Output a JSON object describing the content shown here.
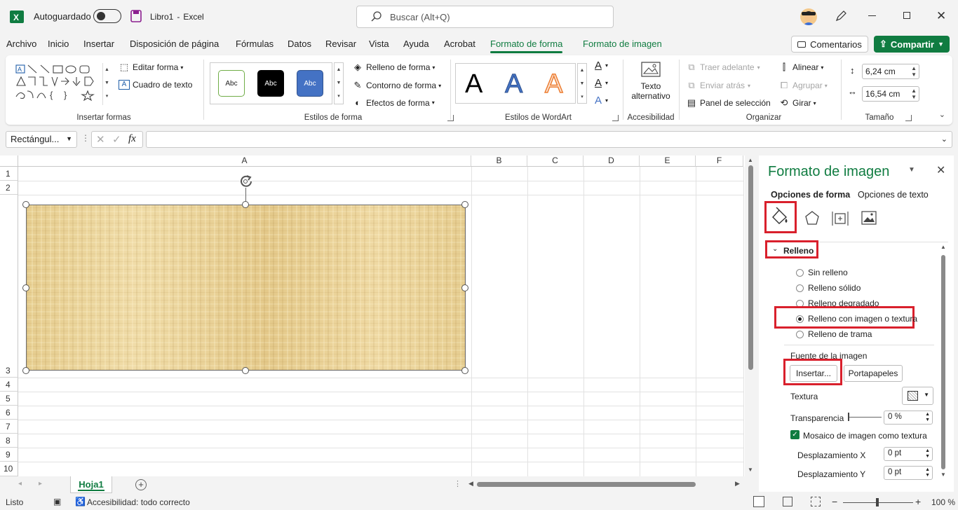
{
  "titlebar": {
    "autosave_label": "Autoguardado",
    "filename": "Libro1",
    "separator": "-",
    "app_name": "Excel",
    "search_placeholder": "Buscar (Alt+Q)"
  },
  "menu": {
    "tabs": [
      "Archivo",
      "Inicio",
      "Insertar",
      "Disposición de página",
      "Fórmulas",
      "Datos",
      "Revisar",
      "Vista",
      "Ayuda",
      "Acrobat",
      "Formato de forma",
      "Formato de imagen"
    ],
    "active_tab": "Formato de forma",
    "comments_label": "Comentarios",
    "share_label": "Compartir"
  },
  "ribbon": {
    "insert_shapes": {
      "label": "Insertar formas",
      "edit_shape": "Editar forma",
      "text_box": "Cuadro de texto"
    },
    "shape_styles": {
      "label": "Estilos de forma",
      "preset1": "Abc",
      "preset2": "Abc",
      "preset3": "Abc",
      "fill": "Relleno de forma",
      "outline": "Contorno de forma",
      "effects": "Efectos de forma"
    },
    "wordart": {
      "label": "Estilos de WordArt",
      "letter": "A"
    },
    "accessibility": {
      "label": "Accesibilidad",
      "alt_text_line1": "Texto",
      "alt_text_line2": "alternativo"
    },
    "arrange": {
      "label": "Organizar",
      "bring_forward": "Traer adelante",
      "send_backward": "Enviar atrás",
      "selection_pane": "Panel de selección",
      "align": "Alinear",
      "group": "Agrupar",
      "rotate": "Girar"
    },
    "size": {
      "label": "Tamaño",
      "height": "6,24 cm",
      "width": "16,54 cm"
    }
  },
  "formula_bar": {
    "name_box": "Rectángul...",
    "fx": "fx",
    "formula": ""
  },
  "grid": {
    "columns": [
      "A",
      "B",
      "C",
      "D",
      "E",
      "F"
    ],
    "rows": [
      "1",
      "2",
      "3",
      "4",
      "5",
      "6",
      "7",
      "8",
      "9",
      "10"
    ]
  },
  "sheet_tabs": {
    "active": "Hoja1"
  },
  "status": {
    "ready": "Listo",
    "accessibility": "Accesibilidad: todo correcto",
    "zoom": "100 %"
  },
  "pane": {
    "title": "Formato de imagen",
    "tab_shape": "Opciones de forma",
    "tab_text": "Opciones de texto",
    "section": "Relleno",
    "options": [
      "Sin relleno",
      "Relleno sólido",
      "Relleno degradado",
      "Relleno con imagen o textura",
      "Relleno de trama"
    ],
    "selected_option": "Relleno con imagen o textura",
    "source_label": "Fuente de la imagen",
    "insert_button": "Insertar...",
    "clipboard_button": "Portapapeles",
    "texture_label": "Textura",
    "transparency_label": "Transparencia",
    "transparency_value": "0 %",
    "tile_label": "Mosaico de imagen como textura",
    "offset_x_label": "Desplazamiento X",
    "offset_x_value": "0 pt",
    "offset_y_label": "Desplazamiento Y",
    "offset_y_value": "0 pt"
  },
  "colors": {
    "accent": "#107c41",
    "highlight": "#d9202c"
  }
}
